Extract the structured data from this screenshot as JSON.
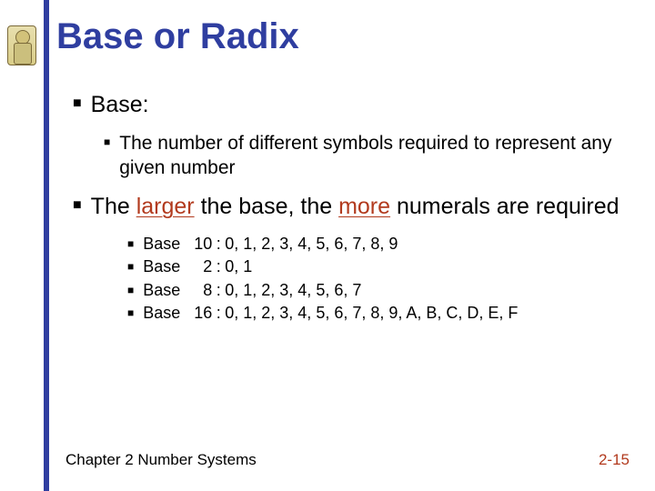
{
  "title": "Base or Radix",
  "points": {
    "baseLabel": "Base:",
    "baseDef": "The number of different symbols required to represent any given number",
    "largerSentence": {
      "part1": "The ",
      "larger": "larger",
      "part2": " the base, the ",
      "more": "more",
      "part3": " numerals are required"
    },
    "bases": [
      {
        "name": "Base",
        "num": "10",
        "digits": "0, 1, 2, 3, 4, 5, 6, 7, 8, 9"
      },
      {
        "name": "Base",
        "num": "2",
        "digits": "0, 1"
      },
      {
        "name": "Base",
        "num": "8",
        "digits": "0, 1, 2, 3, 4, 5, 6, 7"
      },
      {
        "name": "Base",
        "num": "16",
        "digits": "0, 1, 2, 3, 4, 5, 6, 7, 8, 9, A, B, C, D, E, F"
      }
    ]
  },
  "footer": {
    "chapter": "Chapter 2 Number Systems",
    "page": "2-15"
  }
}
